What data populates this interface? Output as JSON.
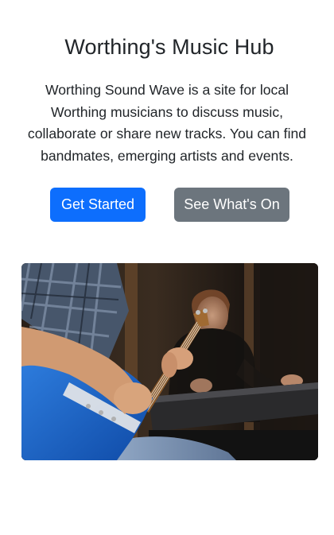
{
  "hero": {
    "title": "Worthing's Music Hub",
    "intro": "Worthing Sound Wave is a site for local Worthing musicians to discuss music, collaborate or share new tracks. You can find bandmates, emerging artists and events.",
    "primary_button": "Get Started",
    "secondary_button": "See What's On"
  },
  "colors": {
    "primary": "#0d6efd",
    "secondary": "#6c757d",
    "text": "#212529",
    "background": "#ffffff"
  }
}
